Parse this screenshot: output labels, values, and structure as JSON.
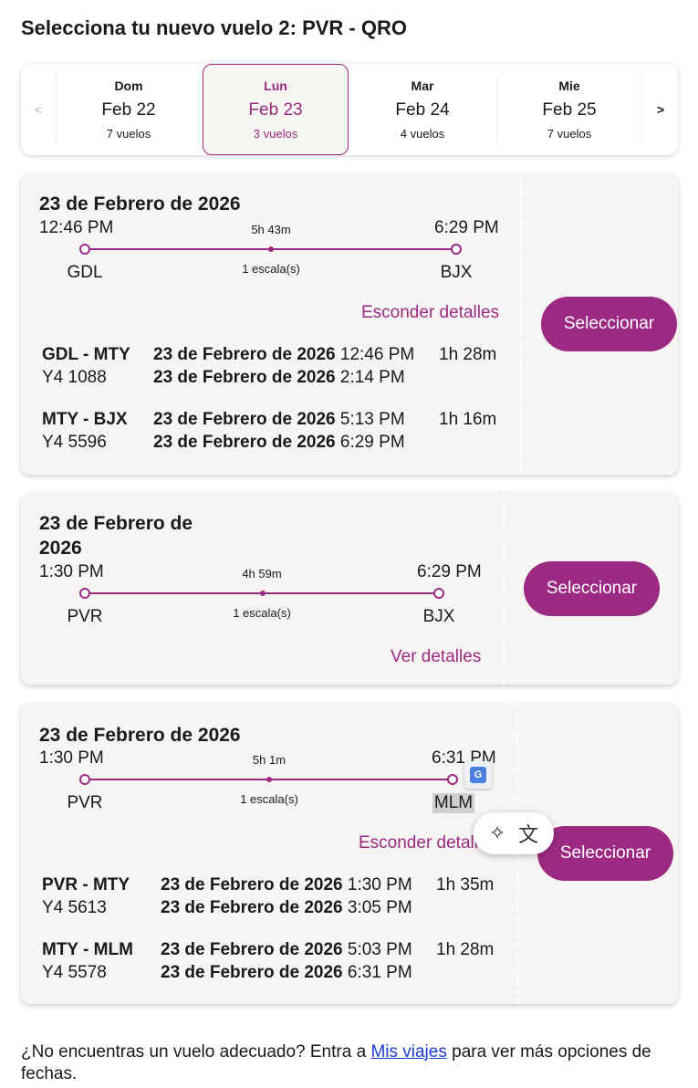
{
  "header": {
    "title": "Selecciona tu nuevo vuelo 2: PVR - QRO"
  },
  "date_selector": {
    "prev_label": "<",
    "next_label": ">",
    "days": [
      {
        "dow": "Dom",
        "date": "Feb 22",
        "count": "7 vuelos",
        "active": false
      },
      {
        "dow": "Lun",
        "date": "Feb 23",
        "count": "3 vuelos",
        "active": true
      },
      {
        "dow": "Mar",
        "date": "Feb 24",
        "count": "4 vuelos",
        "active": false
      },
      {
        "dow": "Mie",
        "date": "Feb 25",
        "count": "7 vuelos",
        "active": false
      }
    ]
  },
  "flights": [
    {
      "date": "23 de Febrero de 2026",
      "depart_time": "12:46 PM",
      "arrive_time": "6:29 PM",
      "duration": "5h 43m",
      "stops": "1 escala(s)",
      "origin": "GDL",
      "destination": "BJX",
      "details_link": "Esconder detalles",
      "select_label": "Seleccionar",
      "segments": [
        {
          "route": "GDL - MTY",
          "flight": "Y4 1088",
          "dep_date": "23 de Febrero de 2026",
          "dep_time": "12:46 PM",
          "arr_date": "23 de Febrero de 2026",
          "arr_time": "2:14 PM",
          "duration": "1h 28m"
        },
        {
          "route": "MTY - BJX",
          "flight": "Y4 5596",
          "dep_date": "23 de Febrero de 2026",
          "dep_time": "5:13 PM",
          "arr_date": "23 de Febrero de 2026",
          "arr_time": "6:29 PM",
          "duration": "1h 16m"
        }
      ]
    },
    {
      "date_line1": "23 de Febrero de",
      "date_line2": "2026",
      "depart_time": "1:30 PM",
      "arrive_time": "6:29 PM",
      "duration": "4h 59m",
      "stops": "1 escala(s)",
      "origin": "PVR",
      "destination": "BJX",
      "details_link": "Ver detalles",
      "select_label": "Seleccionar"
    },
    {
      "date": "23 de Febrero de 2026",
      "depart_time": "1:30 PM",
      "arrive_time": "6:31 PM",
      "duration": "5h 1m",
      "stops": "1 escala(s)",
      "origin": "PVR",
      "destination": "MLM",
      "details_link": "Esconder detalles",
      "select_label": "Seleccionar",
      "segments": [
        {
          "route": "PVR - MTY",
          "flight": "Y4 5613",
          "dep_date": "23 de Febrero de 2026",
          "dep_time": "1:30 PM",
          "arr_date": "23 de Febrero de 2026",
          "arr_time": "3:05 PM",
          "duration": "1h 35m"
        },
        {
          "route": "MTY - MLM",
          "flight": "Y4 5578",
          "dep_date": "23 de Febrero de 2026",
          "dep_time": "5:03 PM",
          "arr_date": "23 de Febrero de 2026",
          "arr_time": "6:31 PM",
          "duration": "1h 28m"
        }
      ]
    }
  ],
  "overlays": {
    "translate_badge_icon": "google-translate-icon",
    "ai_toolbar_icons": [
      "magic-wand-icon",
      "translate-icon"
    ]
  },
  "footer": {
    "text_before": "¿No encuentras un vuelo adecuado? Entra a ",
    "link": "Mis viajes",
    "text_after": " para ver más opciones de fechas."
  },
  "colors": {
    "accent": "#9c2a82",
    "card_bg": "#f6f5f3",
    "link": "#1a3ccf"
  }
}
